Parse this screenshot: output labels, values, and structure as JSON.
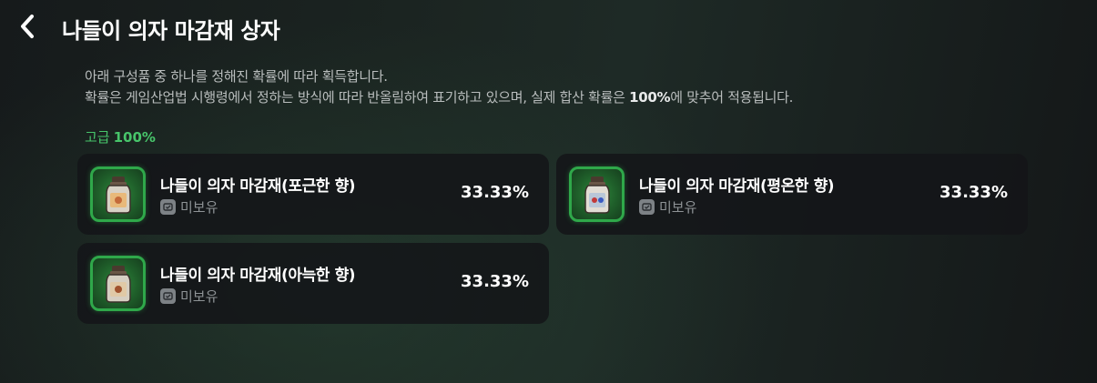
{
  "header": {
    "title": "나들이 의자 마감재 상자",
    "back_icon": "chevron-left-icon"
  },
  "description": {
    "line1": "아래 구성품 중 하나를 정해진 확률에 따라 획득합니다.",
    "line2_prefix": "확률은 게임산업법 시행령에서 정하는 방식에 따라 반올림하여 표기하고 있으며, 실제 합산 확률은 ",
    "line2_bold": "100%",
    "line2_suffix": "에 맞추어 적용됩니다."
  },
  "grade": {
    "label": "고급",
    "total": "100%",
    "color": "#47c46a"
  },
  "items": [
    {
      "name": "나들이 의자 마감재(포근한 향)",
      "status": "미보유",
      "probability": "33.33%",
      "icon": "jar-icon"
    },
    {
      "name": "나들이 의자 마감재(평온한 향)",
      "status": "미보유",
      "probability": "33.33%",
      "icon": "jar-icon"
    },
    {
      "name": "나들이 의자 마감재(아늑한 향)",
      "status": "미보유",
      "probability": "33.33%",
      "icon": "jar-icon"
    }
  ]
}
